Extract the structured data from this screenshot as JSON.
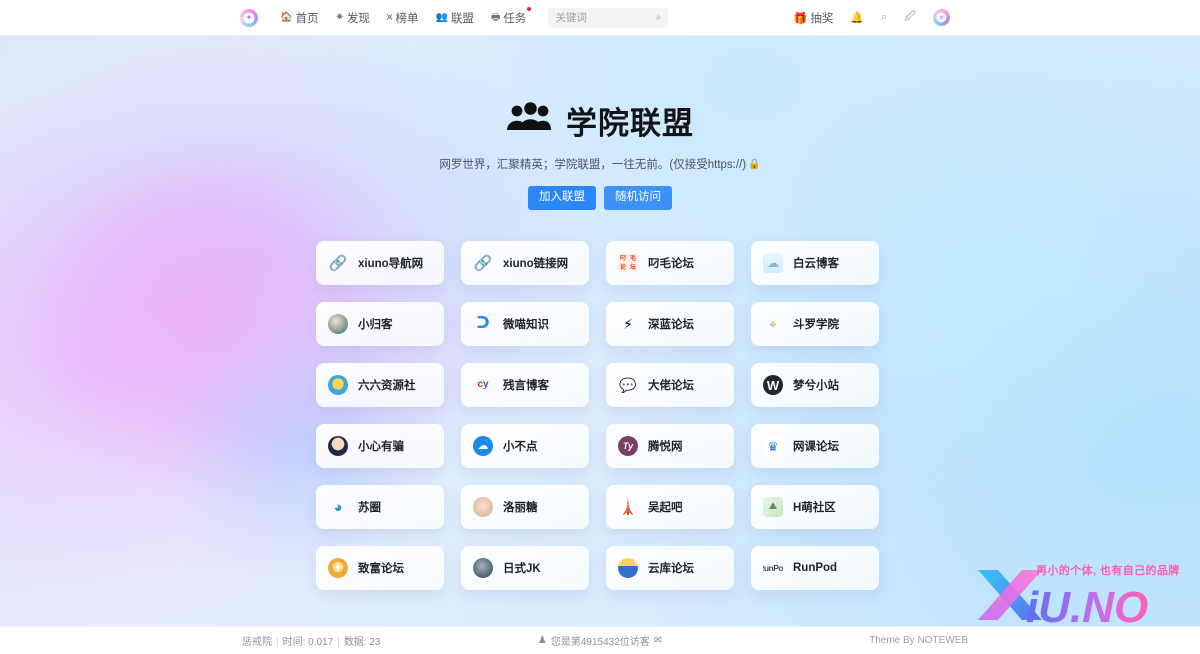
{
  "nav": {
    "logo_icon": "sparkle-logo-icon",
    "menu": [
      {
        "label": "首页",
        "icon": "home-icon",
        "badge": false
      },
      {
        "label": "发现",
        "icon": "compass-icon",
        "badge": false
      },
      {
        "label": "榜单",
        "icon": "chart-icon",
        "badge": false
      },
      {
        "label": "联盟",
        "icon": "users-icon",
        "badge": false
      },
      {
        "label": "任务",
        "icon": "tasks-icon",
        "badge": true
      }
    ],
    "search": {
      "placeholder": "关键词",
      "value": "",
      "icon": "search-icon"
    },
    "right": {
      "lottery_label": "抽奖",
      "lottery_icon": "gift-icon",
      "bell_icon": "bell-icon",
      "search_icon": "search-icon",
      "compose_icon": "compose-icon",
      "avatar_icon": "user-avatar"
    }
  },
  "hero": {
    "title": "学院联盟",
    "title_icon": "users-group-icon",
    "subtitle": "网罗世界，汇聚精英；学院联盟，一往无前。(仅接受https://)",
    "subtitle_icon": "lock-icon",
    "buttons": [
      {
        "label": "加入联盟"
      },
      {
        "label": "随机访问"
      }
    ]
  },
  "cards": [
    {
      "label": "xiuno导航网",
      "icon": "link-edit-icon",
      "icon_class": "ic-xiuno",
      "glyph": "🔗"
    },
    {
      "label": "xiuno链接网",
      "icon": "link-edit-icon",
      "icon_class": "ic-xiuno",
      "glyph": "🔗"
    },
    {
      "label": "叼毛论坛",
      "icon": "red-seal-icon",
      "icon_class": "ic-diaomao",
      "glyph": ""
    },
    {
      "label": "白云博客",
      "icon": "cloud-rabbit-icon",
      "icon_class": "ic-baiyun",
      "glyph": "☁"
    },
    {
      "label": "小归客",
      "icon": "portrait-avatar-icon",
      "icon_class": "ic-xiaogui ico-round",
      "glyph": ""
    },
    {
      "label": "微喵知识",
      "icon": "blue-swirl-icon",
      "icon_class": "ic-weimiao",
      "glyph": "ᑐ"
    },
    {
      "label": "深蓝论坛",
      "icon": "lightning-bolt-icon",
      "icon_class": "ic-shenlan",
      "glyph": "⚡"
    },
    {
      "label": "斗罗学院",
      "icon": "compass-emblem-icon",
      "icon_class": "ic-douluo",
      "glyph": "⌖"
    },
    {
      "label": "六六资源社",
      "icon": "helmet-face-icon",
      "icon_class": "ic-liuliu ico-round",
      "glyph": ""
    },
    {
      "label": "残言博客",
      "icon": "cy-logo-icon",
      "icon_class": "ic-canyan",
      "glyph": ""
    },
    {
      "label": "大佬论坛",
      "icon": "speech-bubbles-icon",
      "icon_class": "ic-dalao",
      "glyph": "💬"
    },
    {
      "label": "梦兮小站",
      "icon": "wordpress-icon",
      "icon_class": "ic-wordpress",
      "glyph": "W"
    },
    {
      "label": "小心有骗",
      "icon": "police-officer-icon",
      "icon_class": "ic-xiaoxin ico-round",
      "glyph": ""
    },
    {
      "label": "小不点",
      "icon": "cloud-icon",
      "icon_class": "ic-xiaobudian ico-round",
      "glyph": "☁"
    },
    {
      "label": "腾悦网",
      "icon": "ty-logo-icon",
      "icon_class": "ic-tengyue ico-round",
      "glyph": "Ty"
    },
    {
      "label": "网课论坛",
      "icon": "crown-icon",
      "icon_class": "ic-wangke",
      "glyph": "♛"
    },
    {
      "label": "苏圈",
      "icon": "blue-spiral-icon",
      "icon_class": "ic-suquan",
      "glyph": "◕"
    },
    {
      "label": "洛丽糖",
      "icon": "cat-avatar-icon",
      "icon_class": "ic-luolitang ico-round",
      "glyph": ""
    },
    {
      "label": "吴起吧",
      "icon": "monument-icon",
      "icon_class": "ic-wuqiba",
      "glyph": "🗼"
    },
    {
      "label": "H萌社区",
      "icon": "landscape-photo-icon",
      "icon_class": "ic-hmeng",
      "glyph": "⛰"
    },
    {
      "label": "致富论坛",
      "icon": "gold-coin-icon",
      "icon_class": "ic-zhifu ico-round",
      "glyph": "✦"
    },
    {
      "label": "日式JK",
      "icon": "photo-avatar-icon",
      "icon_class": "ic-rishi ico-round",
      "glyph": ""
    },
    {
      "label": "云库论坛",
      "icon": "sun-cloud-icon",
      "icon_class": "ic-yunku ico-round",
      "glyph": ""
    },
    {
      "label": "RunPod",
      "icon": "runpod-logo-icon",
      "icon_class": "ic-runpod",
      "glyph": "RunPod"
    }
  ],
  "watermark": {
    "brand": "XiU.NO",
    "tagline": "再小的个体, 也有自己的品牌"
  },
  "footer": {
    "site_name": "惩戒院",
    "time_label": "时间: 0.017",
    "data_label": "数据: 23",
    "visitor_icon": "person-icon",
    "visitor_text": "您是第4915432位访客",
    "mail_icon": "mail-icon",
    "theme_credit": "Theme By NOTEWEB"
  }
}
